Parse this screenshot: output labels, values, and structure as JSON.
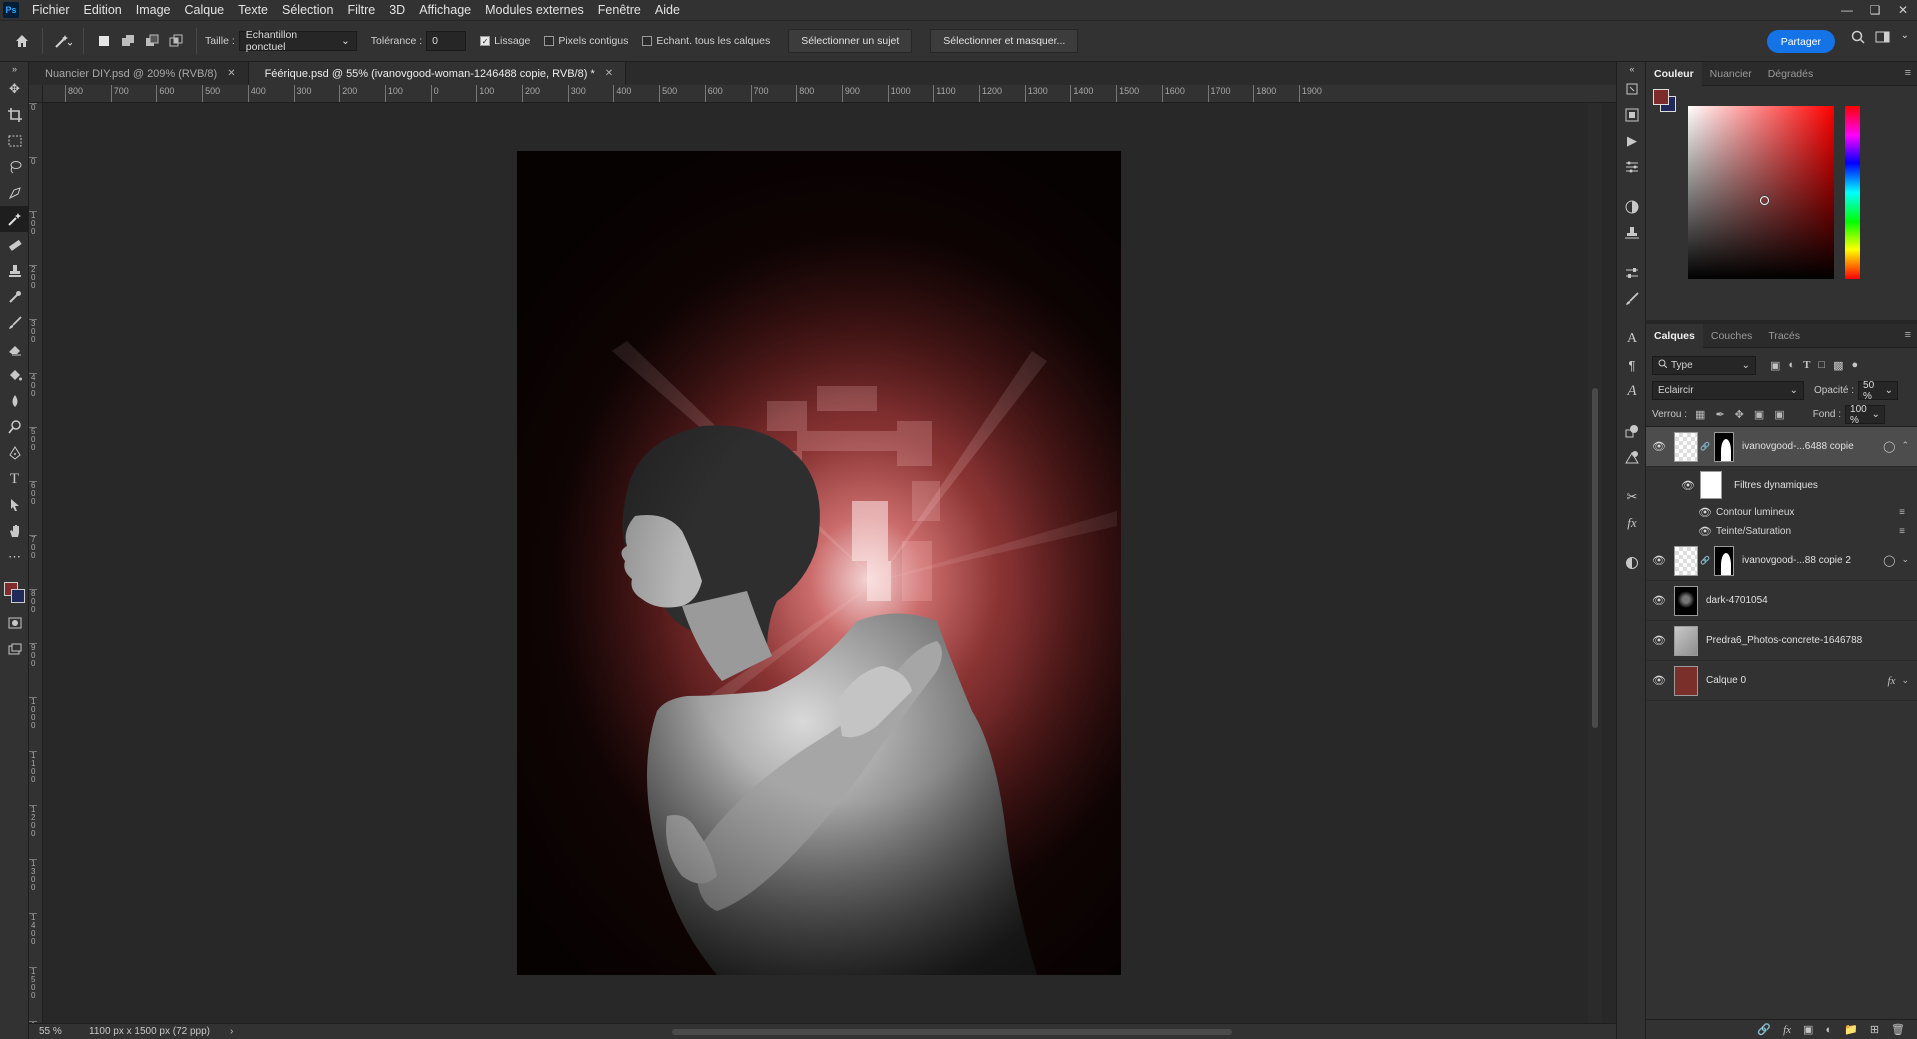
{
  "menu": {
    "logo": "Ps",
    "items": [
      "Fichier",
      "Edition",
      "Image",
      "Calque",
      "Texte",
      "Sélection",
      "Filtre",
      "3D",
      "Affichage",
      "Modules externes",
      "Fenêtre",
      "Aide"
    ]
  },
  "options": {
    "size_label": "Taille :",
    "size_value": "Echantillon ponctuel",
    "tolerance_label": "Tolérance :",
    "tolerance_value": "0",
    "antialias": {
      "label": "Lissage",
      "checked": true
    },
    "contiguous": {
      "label": "Pixels contigus",
      "checked": false
    },
    "all_layers": {
      "label": "Echant. tous les calques",
      "checked": false
    },
    "select_subject": "Sélectionner un sujet",
    "select_mask": "Sélectionner et masquer...",
    "share": "Partager"
  },
  "tabs": [
    {
      "label": "Nuancier DIY.psd @ 209% (RVB/8)",
      "active": false
    },
    {
      "label": "Féérique.psd @ 55% (ivanovgood-woman-1246488 copie, RVB/8) *",
      "active": true
    }
  ],
  "ruler_h": [
    "800",
    "700",
    "600",
    "500",
    "400",
    "300",
    "200",
    "100",
    "0",
    "100",
    "200",
    "300",
    "400",
    "500",
    "600",
    "700",
    "800",
    "900",
    "1000",
    "1100",
    "1200",
    "1300",
    "1400",
    "1500",
    "1600",
    "1700",
    "1800",
    "1900"
  ],
  "ruler_v": [
    "0",
    "0",
    "1 0 0",
    "2 0 0",
    "3 0 0",
    "4 0 0",
    "5 0 0",
    "6 0 0",
    "7 0 0",
    "8 0 0",
    "9 0 0",
    "1 0 0 0",
    "1 1 0 0",
    "1 2 0 0",
    "1 3 0 0",
    "1 4 0 0",
    "1 5 0 0",
    "1 6 0 0"
  ],
  "status": {
    "zoom": "55 %",
    "doc_info": "1100 px x 1500 px (72 ppp)"
  },
  "color_panel": {
    "tabs": [
      "Couleur",
      "Nuancier",
      "Dégradés"
    ],
    "foreground": "#7e2b2b",
    "background": "#1f2a5a"
  },
  "layers_panel": {
    "tabs": [
      "Calques",
      "Couches",
      "Tracés"
    ],
    "filter_kind": "Type",
    "blend_mode": "Eclaircir",
    "opacity_label": "Opacité :",
    "opacity_value": "50 %",
    "lock_label": "Verrou :",
    "fill_label": "Fond :",
    "fill_value": "100 %",
    "layers": [
      {
        "name": "ivanovgood-...6488 copie",
        "selected": true,
        "has_mask": true
      },
      {
        "name": "ivanovgood-...88 copie 2",
        "selected": false,
        "has_mask": true
      },
      {
        "name": "dark-4701054",
        "selected": false,
        "has_mask": false
      },
      {
        "name": "Predra6_Photos-concrete-1646788",
        "selected": false,
        "has_mask": false
      },
      {
        "name": "Calque 0",
        "selected": false,
        "has_mask": false
      }
    ],
    "smart_filters_label": "Filtres dynamiques",
    "filters": [
      "Contour lumineux",
      "Teinte/Saturation"
    ],
    "layer0_color": "#7a2f2a"
  }
}
